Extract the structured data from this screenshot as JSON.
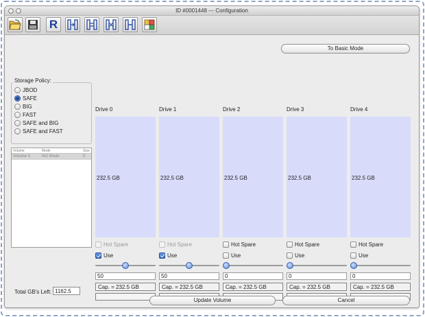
{
  "window": {
    "title": "ID #0001448 --- Configuration"
  },
  "toolbar": {
    "buttons": [
      {
        "name": "open-folder-icon"
      },
      {
        "name": "save-disk-icon"
      },
      {
        "name": "r-letter-icon",
        "label": "R"
      },
      {
        "name": "raid-mode-1-icon"
      },
      {
        "name": "raid-mode-2-icon"
      },
      {
        "name": "raid-mode-3-icon"
      },
      {
        "name": "raid-mode-4-icon"
      },
      {
        "name": "layout-grid-icon"
      }
    ]
  },
  "basic_mode_button": "To Basic Mode",
  "storage_policy": {
    "title": "Storage Policy:",
    "options": [
      {
        "label": "JBOD",
        "selected": false
      },
      {
        "label": "SAFE",
        "selected": true
      },
      {
        "label": "BIG",
        "selected": false
      },
      {
        "label": "FAST",
        "selected": false
      },
      {
        "label": "SAFE and BIG",
        "selected": false
      },
      {
        "label": "SAFE and FAST",
        "selected": false
      }
    ]
  },
  "volume_table": {
    "columns": [
      "Volume",
      "Mode",
      "Size"
    ],
    "rows": [
      {
        "volume": "Volume 0",
        "mode": "NO Mode",
        "size": "0"
      }
    ]
  },
  "drives": [
    {
      "label": "Drive 0",
      "size": "232.5 GB",
      "hot_spare": "Hot Spare",
      "hot_spare_enabled": false,
      "use": "Use",
      "use_checked": true,
      "slider_value": 50,
      "value": "50",
      "capacity": "Cap. = 232.5 GB"
    },
    {
      "label": "Drive 1",
      "size": "232.5 GB",
      "hot_spare": "Hot Spare",
      "hot_spare_enabled": false,
      "use": "Use",
      "use_checked": true,
      "slider_value": 50,
      "value": "50",
      "capacity": "Cap. = 232.5 GB"
    },
    {
      "label": "Drive 2",
      "size": "232.5 GB",
      "hot_spare": "Hot Spare",
      "hot_spare_enabled": true,
      "use": "Use",
      "use_checked": false,
      "slider_value": 0,
      "value": "0",
      "capacity": "Cap. = 232.5 GB"
    },
    {
      "label": "Drive 3",
      "size": "232.5 GB",
      "hot_spare": "Hot Spare",
      "hot_spare_enabled": true,
      "use": "Use",
      "use_checked": false,
      "slider_value": 0,
      "value": "0",
      "capacity": "Cap. = 232.5 GB"
    },
    {
      "label": "Drive 4",
      "size": "232.5 GB",
      "hot_spare": "Hot Spare",
      "hot_spare_enabled": true,
      "use": "Use",
      "use_checked": false,
      "slider_value": 0,
      "value": "0",
      "capacity": "Cap. = 232.5 GB"
    }
  ],
  "total_left": {
    "label": "Total GB's Left:",
    "value": "1162.5"
  },
  "footer": {
    "update_button": "Update Volume",
    "cancel_button": "Cancel"
  },
  "colors": {
    "drive_area": "#d8dcfa",
    "accent": "#3d6fc4",
    "window_bg": "#ececec"
  }
}
